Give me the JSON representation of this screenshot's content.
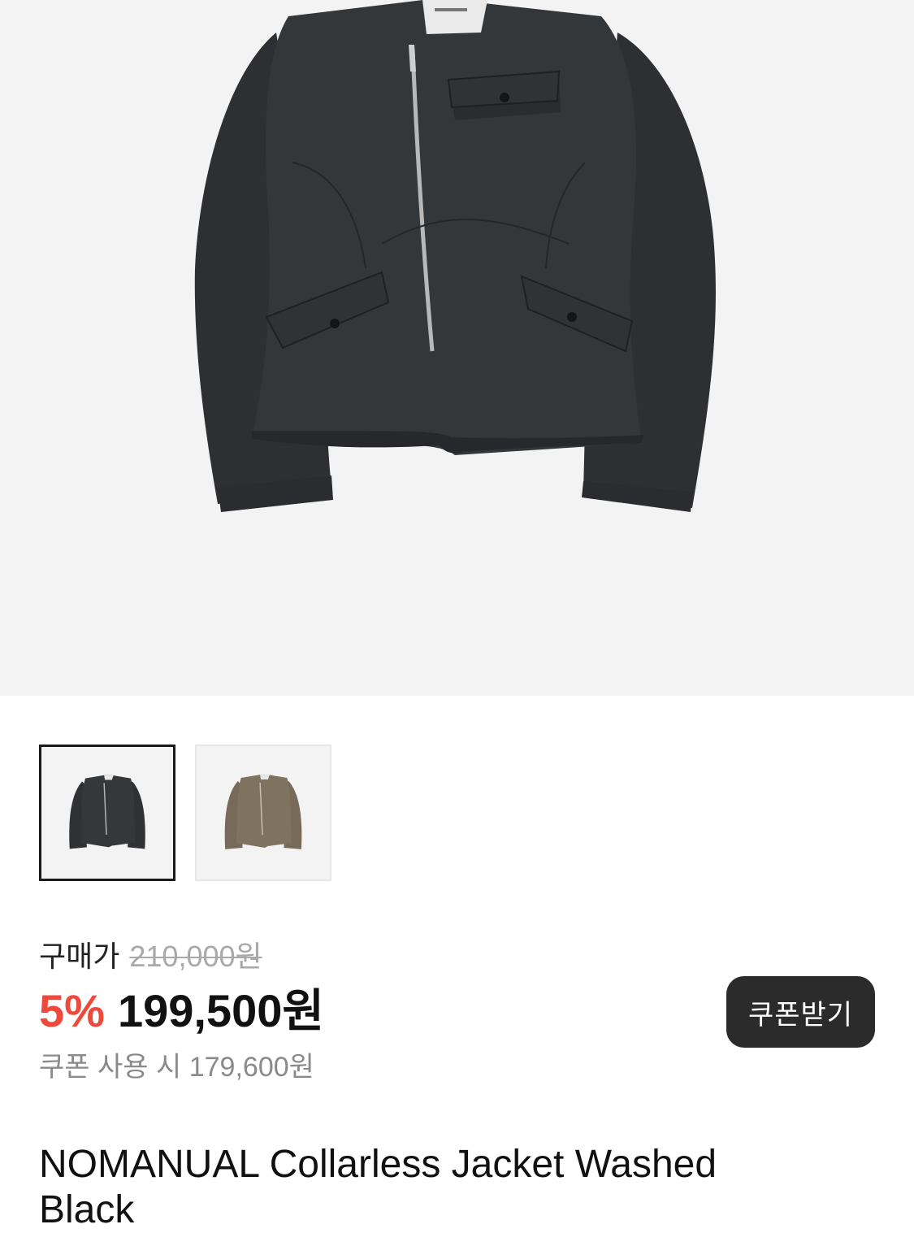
{
  "product": {
    "title": "NOMANUAL Collarless Jacket Washed Black",
    "brand_tag": "NOMANUAL"
  },
  "gallery": {
    "main_image": "jacket-washed-black",
    "thumbnails": [
      {
        "name": "Washed Black",
        "color": "#2f3134",
        "selected": true
      },
      {
        "name": "Khaki",
        "color": "#7b6e5d",
        "selected": false
      }
    ]
  },
  "pricing": {
    "label": "구매가",
    "original_price": "210,000원",
    "discount": "5%",
    "sale_price": "199,500원",
    "coupon_price_text": "쿠폰 사용 시 179,600원",
    "coupon_button_label": "쿠폰받기"
  },
  "colors": {
    "discount": "#ee4a3c",
    "button_bg": "#2b2b2b",
    "hero_bg": "#f3f3f3"
  }
}
